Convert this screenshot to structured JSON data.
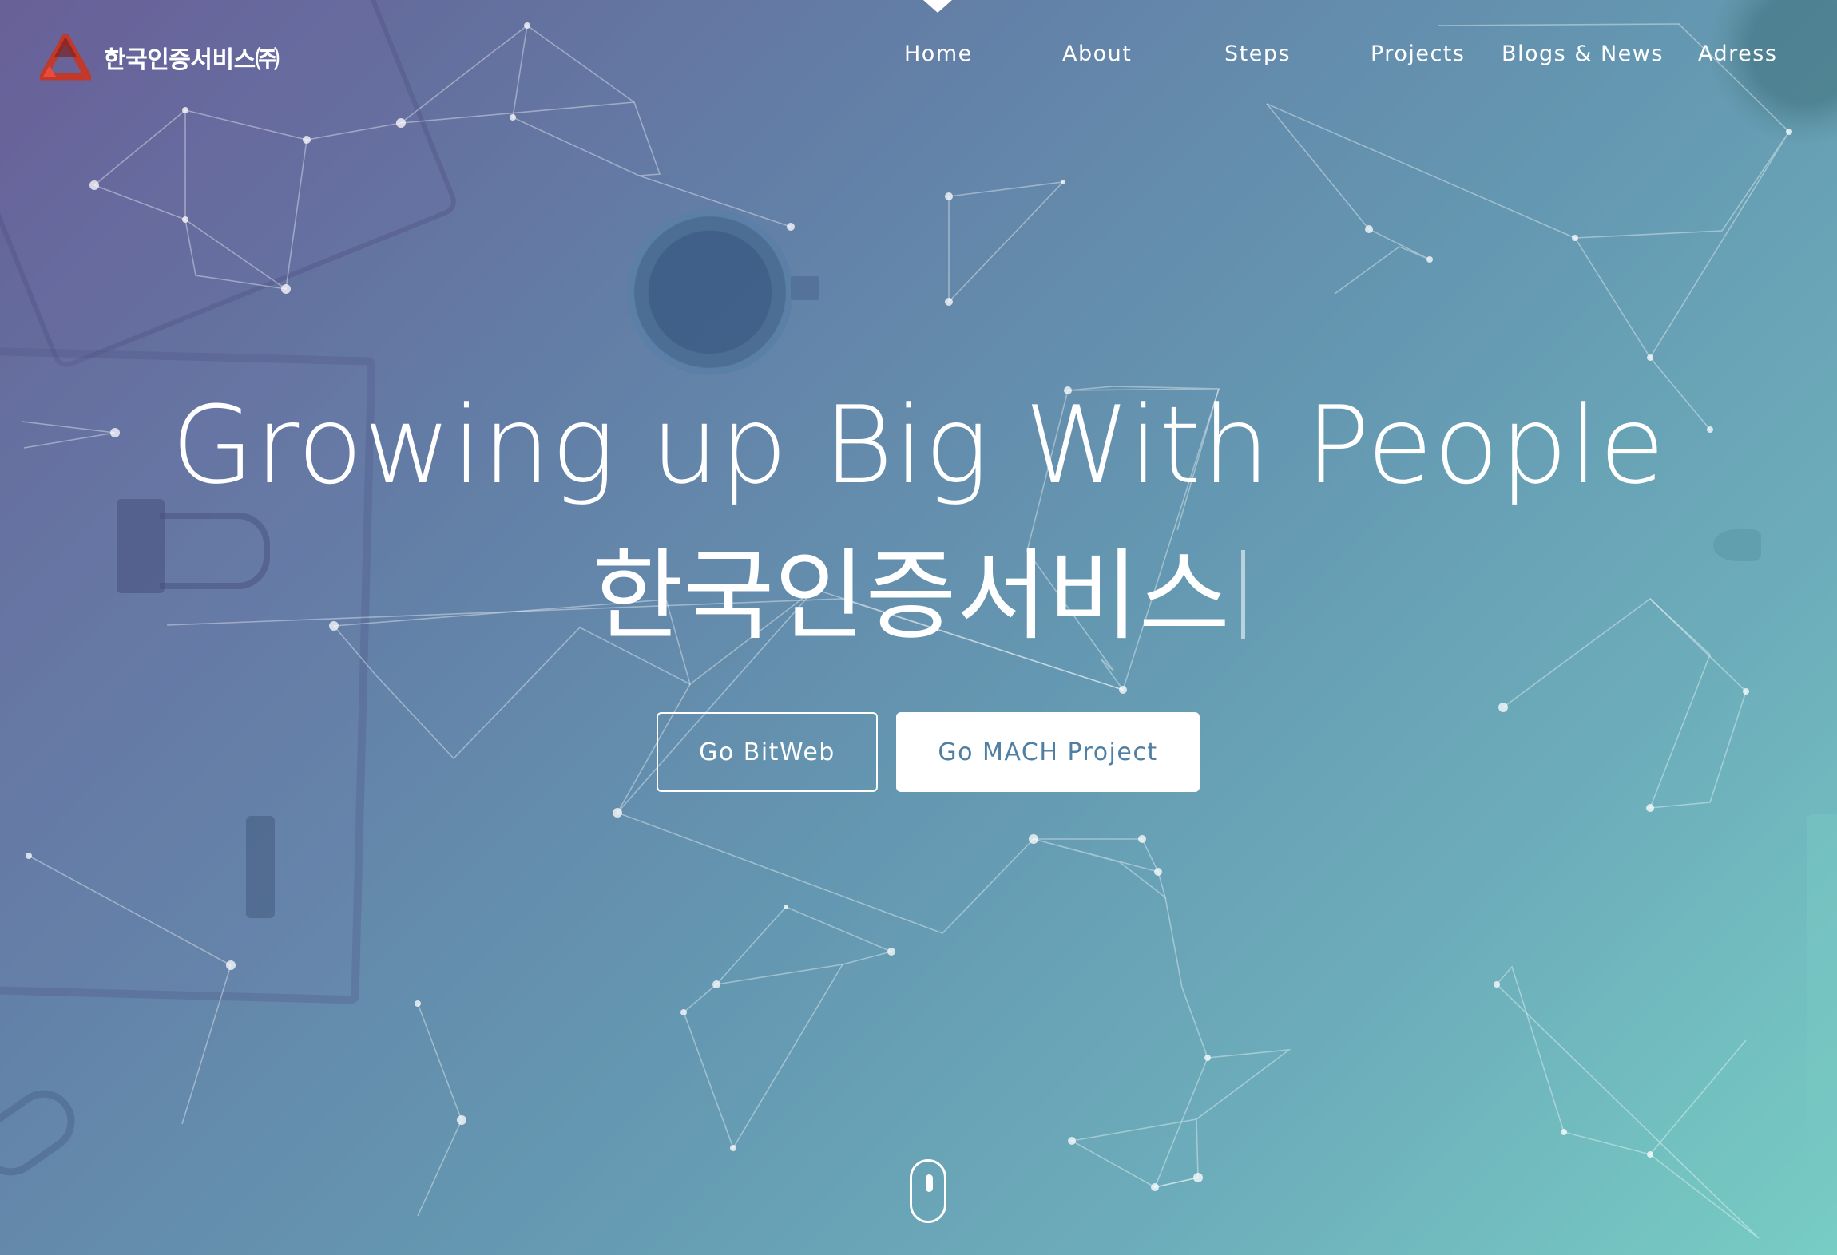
{
  "brand": {
    "name": "한국인증서비스㈜",
    "logo": "triangle-logo-icon",
    "logo_colors": [
      "#c0392b",
      "#e74c3c",
      "#7a1f1f"
    ]
  },
  "nav": {
    "items": [
      {
        "label": "Home",
        "active": true
      },
      {
        "label": "About"
      },
      {
        "label": "Steps"
      },
      {
        "label": "Projects"
      },
      {
        "label": "Blogs & News"
      },
      {
        "label": "Adress"
      }
    ]
  },
  "hero": {
    "headline": "Growing up Big With People",
    "subheadline": "한국인증서비스",
    "buttons": {
      "primary_outline": "Go BitWeb",
      "primary_solid": "Go MACH Project"
    },
    "scroll_indicator": "mouse-scroll-icon"
  },
  "colors": {
    "gradient_start": "#665f96",
    "gradient_mid": "#6497b1",
    "gradient_end": "#77cdc4",
    "button_text": "#4f7fa3",
    "text": "#ffffff"
  }
}
